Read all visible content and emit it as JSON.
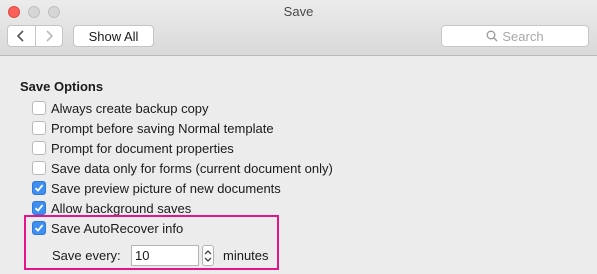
{
  "window": {
    "title": "Save"
  },
  "toolbar": {
    "back_icon": "chevron-left-icon",
    "forward_icon": "chevron-right-icon",
    "show_all_label": "Show All",
    "search_placeholder": "Search"
  },
  "section": {
    "title": "Save Options"
  },
  "options": [
    {
      "label": "Always create backup copy",
      "checked": false
    },
    {
      "label": "Prompt before saving Normal template",
      "checked": false
    },
    {
      "label": "Prompt for document properties",
      "checked": false
    },
    {
      "label": "Save data only for forms (current document only)",
      "checked": false
    },
    {
      "label": "Save preview picture of new documents",
      "checked": true
    },
    {
      "label": "Allow background saves",
      "checked": true
    },
    {
      "label": "Save AutoRecover info",
      "checked": true
    }
  ],
  "autorecover": {
    "save_every_label": "Save every:",
    "interval_value": "10",
    "unit_label": "minutes"
  },
  "colors": {
    "checkbox_checked": "#3d8ef0",
    "highlight_border": "#e4158a",
    "close_button": "#fc605b"
  }
}
